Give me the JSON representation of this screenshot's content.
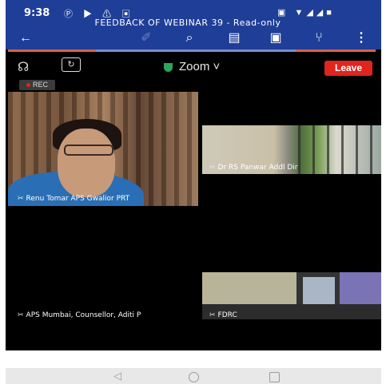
{
  "status_bar": {
    "time": "9:38",
    "left_icons": "Ⓟ ▶ ⚠ ▣",
    "right_icons": "▣ ▼◢◢■"
  },
  "document": {
    "title": "FEEDBACK OF WEBINAR 39 - Read-only"
  },
  "toolbar": {
    "back_icon": "←",
    "pen_icon": "✐",
    "search_icon": "⌕",
    "doc_icon": "▤",
    "save_icon": "▣",
    "share_icon": "⑂",
    "more_icon": "⋮"
  },
  "meeting": {
    "app_label": "Zoom ˅",
    "leave_label": "Leave",
    "rec_label": "REC",
    "audio_icon": "☊",
    "camera_flip_icon": "↻",
    "accent_color": "#e0251e"
  },
  "participants": [
    {
      "name": "Renu Tomar APS Gwalior PRT"
    },
    {
      "name": "Dr RS Panwar Addl Dir"
    },
    {
      "name": "APS Mumbai, Counsellor, Aditi P"
    },
    {
      "name": "FDRC"
    }
  ],
  "mic_icon": "✂",
  "nav": {
    "back": "◁"
  }
}
